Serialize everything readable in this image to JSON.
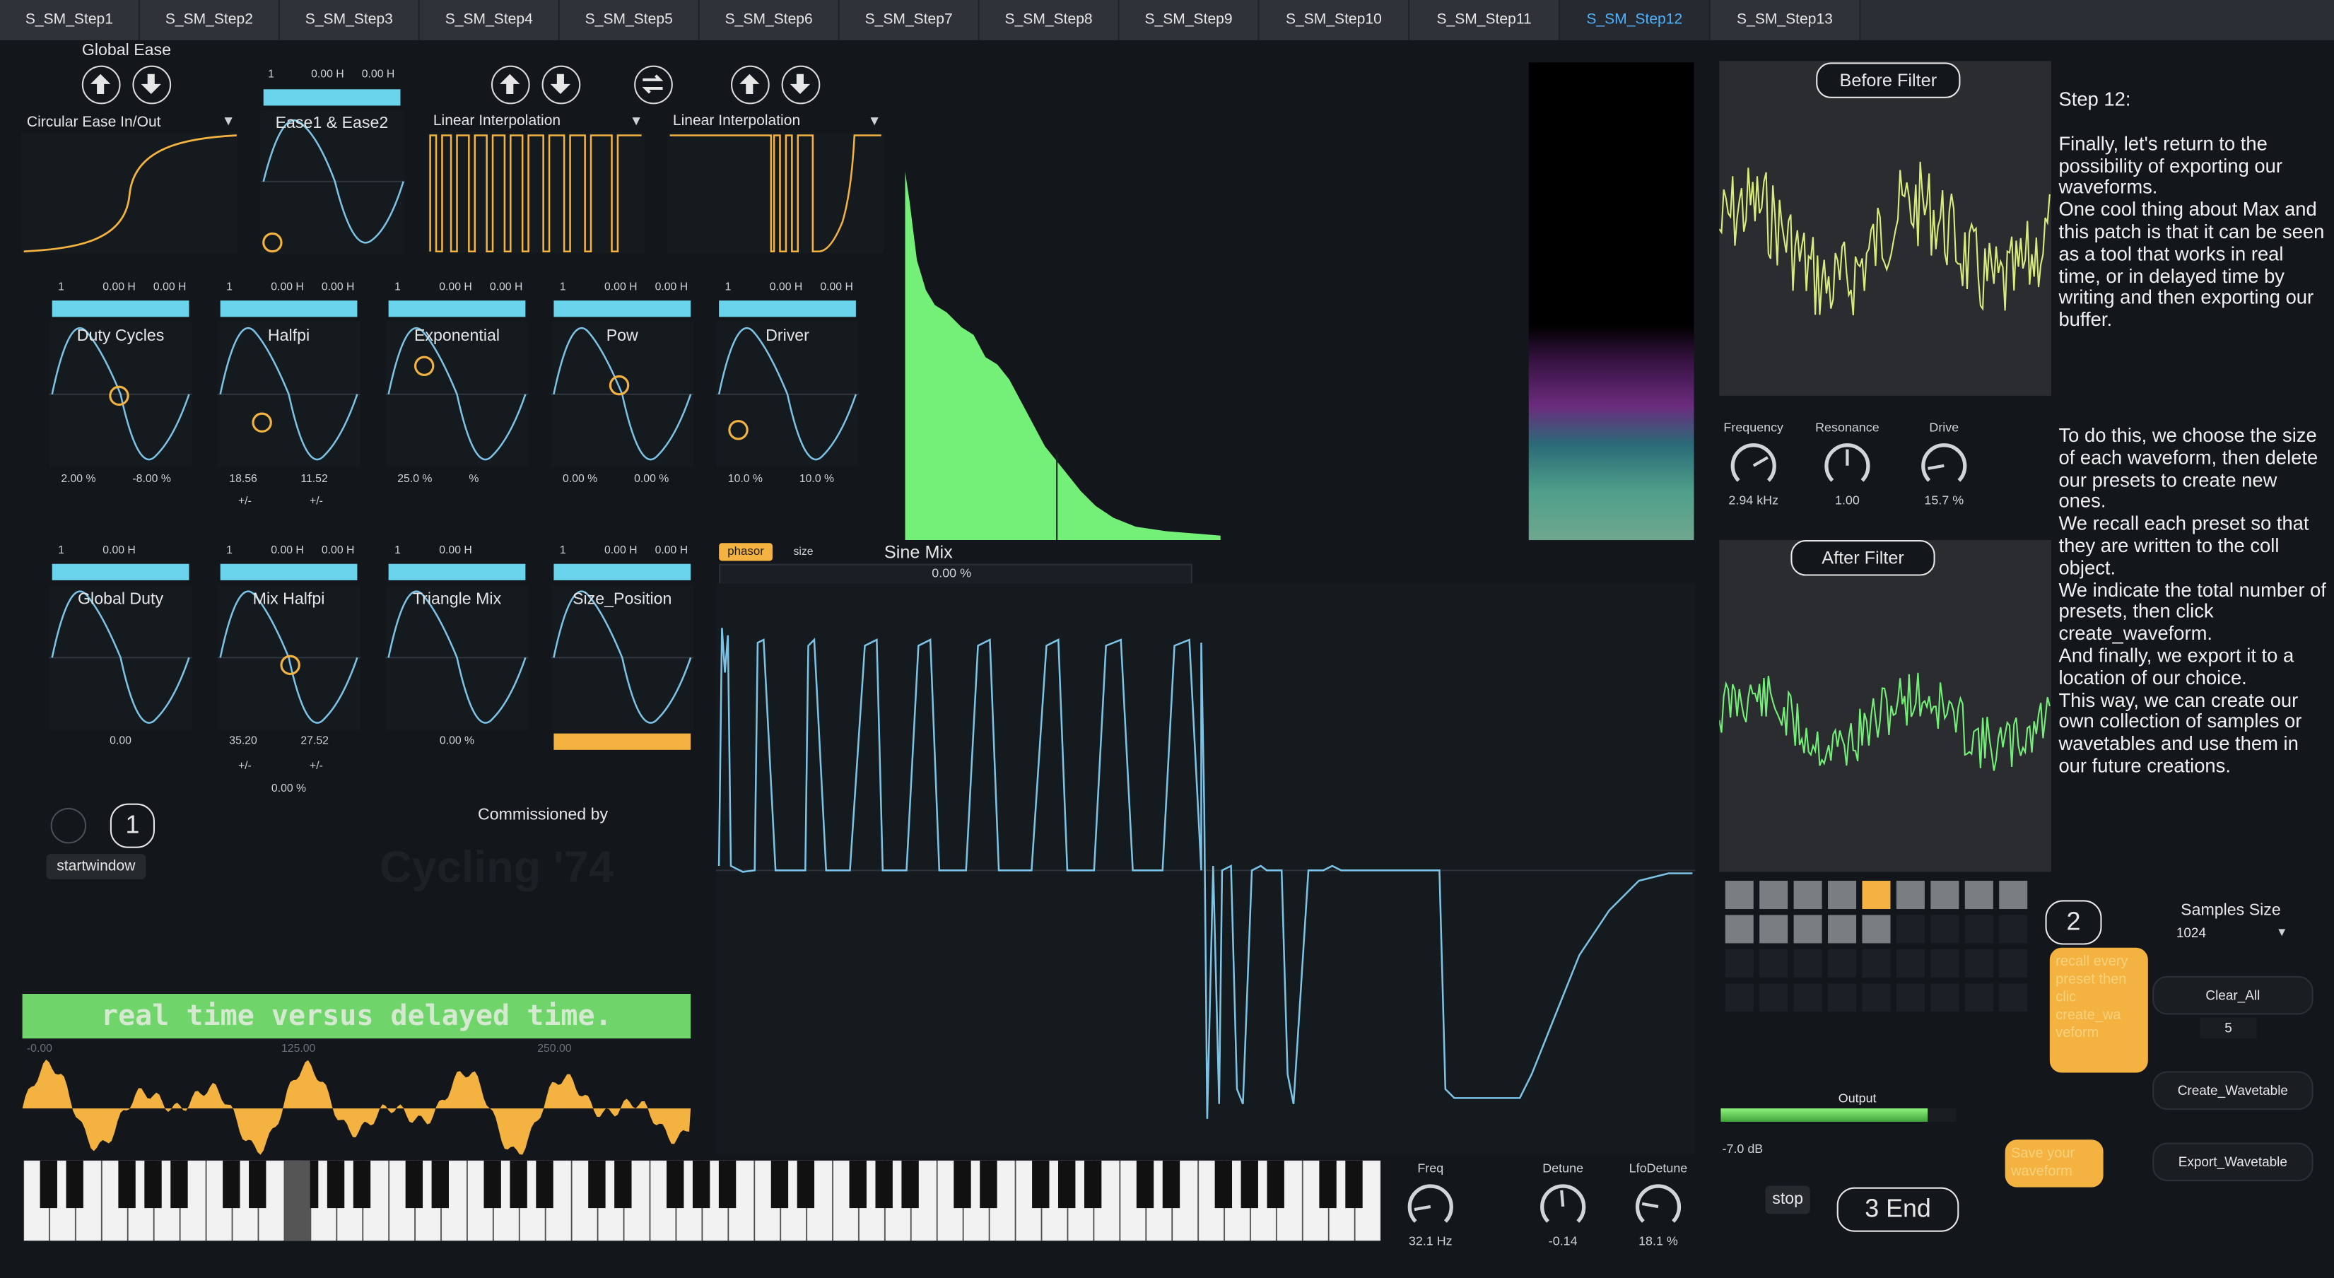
{
  "tabs": [
    "S_SM_Step1",
    "S_SM_Step2",
    "S_SM_Step3",
    "S_SM_Step4",
    "S_SM_Step5",
    "S_SM_Step6",
    "S_SM_Step7",
    "S_SM_Step8",
    "S_SM_Step9",
    "S_SM_Step10",
    "S_SM_Step11",
    "S_SM_Step12",
    "S_SM_Step13"
  ],
  "active_tab": "S_SM_Step12",
  "global_ease": {
    "title": "Global Ease",
    "dropdown": "Circular Ease In/Out"
  },
  "ease_box": {
    "num": "1",
    "v1": "0.00 H",
    "v2": "0.00 H",
    "label": "Ease1 & Ease2"
  },
  "interp1": "Linear Interpolation",
  "interp2": "Linear Interpolation",
  "row1": [
    {
      "name": "Duty Cycles",
      "num": "1",
      "v1": "0.00 H",
      "v2": "0.00 H",
      "left": "2.00 %",
      "right": "-8.00 %"
    },
    {
      "name": "Halfpi",
      "num": "1",
      "v1": "0.00 H",
      "v2": "0.00 H",
      "left": "18.56",
      "right": "11.52",
      "pm": "+/-"
    },
    {
      "name": "Exponential",
      "num": "1",
      "v1": "0.00 H",
      "v2": "0.00 H",
      "left": "25.0 %",
      "right": "%"
    },
    {
      "name": "Pow",
      "num": "1",
      "v1": "0.00 H",
      "v2": "0.00 H",
      "left": "0.00 %",
      "right": "0.00 %"
    },
    {
      "name": "Driver",
      "num": "1",
      "v1": "0.00 H",
      "v2": "0.00 H",
      "left": "10.0 %",
      "right": "10.0 %"
    }
  ],
  "row2": [
    {
      "name": "Global Duty",
      "num": "1",
      "v1": "0.00 H",
      "bottom": "0.00"
    },
    {
      "name": "Mix Halfpi",
      "num": "1",
      "v1": "0.00 H",
      "v2": "0.00 H",
      "left": "35.20",
      "right": "27.52",
      "pm": "+/-",
      "extra": "0.00 %"
    },
    {
      "name": "Triangle Mix",
      "num": "1",
      "v1": "0.00 H",
      "bottom": "0.00 %"
    },
    {
      "name": "Size_Position",
      "num": "1",
      "v1": "0.00 H",
      "v2": "0.00 H"
    }
  ],
  "startwindow": "startwindow",
  "bubble1": "1",
  "commissioned": "Commissioned by",
  "cycling": "Cycling '74",
  "banner": "real time versus delayed time.",
  "ruler": [
    "-0.00",
    "125.00",
    "250.00"
  ],
  "phasor_btn": "phasor",
  "size_btn": "size",
  "sine_mix": {
    "label": "Sine Mix",
    "value": "0.00 %"
  },
  "before_filter": "Before Filter",
  "after_filter": "After Filter",
  "knobs_filter": [
    {
      "label": "Frequency",
      "value": "2.94 kHz"
    },
    {
      "label": "Resonance",
      "value": "1.00"
    },
    {
      "label": "Drive",
      "value": "15.7 %"
    }
  ],
  "step_text": {
    "p1": "Step 12:",
    "p2": "Finally, let's return to the possibility of exporting our waveforms.",
    "p3": "One cool thing about Max and this patch is that it can be seen as a tool that works in real time, or in delayed time by writing and then exporting our buffer.",
    "p4": "To do this, we choose the size of each waveform, then delete our presets to create new ones.",
    "p5": "We recall each preset so that they are written to the coll object.",
    "p6": "We indicate the total number of presets, then click create_waveform.",
    "p7": "And finally, we export it to a location of our choice.",
    "p8": "This way, we can create our own collection of samples or wavetables and use them in our future creations."
  },
  "bubble2": "2",
  "comment_recall": "recall every preset then clic create_wa veform",
  "comment_save": "Save your waveform",
  "samples_size": {
    "label": "Samples Size",
    "value": "1024"
  },
  "clear_all": "Clear_All",
  "num5": "5",
  "create_wavetable": "Create_Wavetable",
  "export_wavetable": "Export_Wavetable",
  "output": {
    "label": "Output",
    "db": "-7.0 dB",
    "level": 0.88
  },
  "stop_btn": "stop",
  "end_bubble": "3 End",
  "synth_knobs": [
    {
      "label": "Freq",
      "value": "32.1 Hz"
    },
    {
      "label": "Detune",
      "value": "-0.14"
    },
    {
      "label": "LfoDetune",
      "value": "18.1 %"
    }
  ],
  "colors": {
    "accent": "#69d4ec",
    "orange": "#f4b340",
    "green": "#74ef78",
    "active_tab": "#4fb3ff"
  }
}
